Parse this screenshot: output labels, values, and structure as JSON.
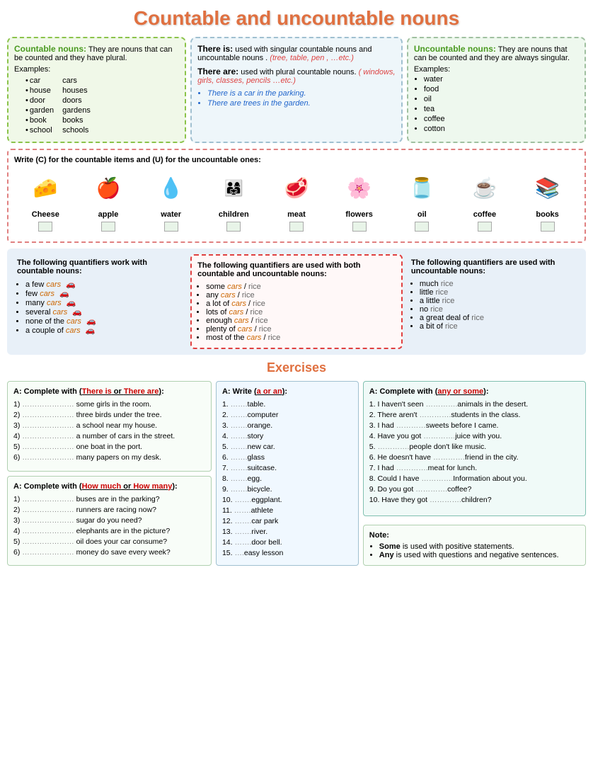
{
  "title": "Countable and uncountable nouns",
  "countable": {
    "title": "Countable nouns:",
    "desc": "They are nouns that can be counted and they have plural.",
    "examples_label": "Examples:",
    "items": [
      {
        "singular": "car",
        "plural": "cars"
      },
      {
        "singular": "house",
        "plural": "houses"
      },
      {
        "singular": "door",
        "plural": "doors"
      },
      {
        "singular": "garden",
        "plural": "gardens"
      },
      {
        "singular": "book",
        "plural": "books"
      },
      {
        "singular": "school",
        "plural": "schools"
      }
    ]
  },
  "there": {
    "there_is_title": "There is:",
    "there_is_desc": "used with singular countable nouns and uncountable nouns .",
    "there_is_examples": "(tree, table, pen , …etc.)",
    "there_are_title": "There are:",
    "there_are_desc": "used with plural countable nouns.",
    "there_are_examples": "( windows, girls, classes, pencils …etc.)",
    "bullets": [
      "There is a car in the parking.",
      "There are trees in the garden."
    ]
  },
  "uncountable": {
    "title": "Uncountable nouns:",
    "desc": "They are nouns that can be counted and they are always singular.",
    "examples_label": "Examples:",
    "items": [
      "water",
      "food",
      "oil",
      "tea",
      "coffee",
      "cotton"
    ]
  },
  "write_exercise": {
    "title": "Write (C) for the countable items and (U) for the uncountable ones:",
    "items": [
      {
        "label": "Cheese",
        "icon": "🧀"
      },
      {
        "label": "apple",
        "icon": "🍎"
      },
      {
        "label": "water",
        "icon": "💧"
      },
      {
        "label": "children",
        "icon": "👨‍👩‍👧"
      },
      {
        "label": "meat",
        "icon": "🥩"
      },
      {
        "label": "flowers",
        "icon": "🌸"
      },
      {
        "label": "oil",
        "icon": "🫙"
      },
      {
        "label": "coffee",
        "icon": "☕"
      },
      {
        "label": "books",
        "icon": "📚"
      }
    ]
  },
  "quantifiers": {
    "countable_title": "The following quantifiers work with countable nouns:",
    "countable_items": [
      "a few cars",
      "few cars",
      "many  cars",
      "several cars",
      "none of the cars",
      "a couple of cars"
    ],
    "both_title": "The following quantifiers are used with both countable and uncountable nouns:",
    "both_items": [
      "some cars / rice",
      "any cars / rice",
      "a lot of cars / rice",
      "lots of cars / rice",
      "enough cars / rice",
      "plenty of cars / rice",
      "most of the cars / rice"
    ],
    "uncountable_title": "The following quantifiers are used with uncountable nouns:",
    "uncountable_items": [
      "much rice",
      "little rice",
      "a little rice",
      "no rice",
      "a great deal of rice",
      "a bit of rice"
    ]
  },
  "exercises_title": "Exercises",
  "ex1": {
    "title": "A: Complete with (There is or There are):",
    "items": [
      "………………… some girls in the room.",
      "………………… three birds under the tree.",
      "………………… a school near my house.",
      "………………… a number of cars in the street.",
      "………………… one boat in the port.",
      "………………… many papers on my desk."
    ]
  },
  "ex2": {
    "title": "A: Complete with (How much  or How many):",
    "items": [
      "………………… buses are in the parking?",
      "………………… runners are racing now?",
      "………………… sugar do you need?",
      "………………… elephants are in the picture?",
      "………………… oil does your car consume?",
      "………………… money do save every week?"
    ]
  },
  "ex3": {
    "title": "A: Write (a or an):",
    "items": [
      "…….table.",
      "…….computer",
      "…….orange.",
      "…….story",
      "…….new car.",
      "…….glass",
      "…….suitcase.",
      "…….egg.",
      "…….bicycle.",
      "…….eggplant.",
      "…….athlete",
      "…….car park",
      "…….river.",
      "…….door bell.",
      "….easy lesson"
    ]
  },
  "ex4": {
    "title": "A: Complete with (any or some):",
    "items": [
      "I haven't seen ………….animals in the desert.",
      "There aren't ………….students in the class.",
      "I had …………sweets before I came.",
      "Have you got ………….juice with you.",
      "………….people don't like music.",
      "He doesn't have ………….friend in the city.",
      "I had ………….meat for lunch.",
      "Could I have ………….Information about you.",
      "Do you got ………….coffee?",
      "Have they got ………….children?"
    ]
  },
  "note": {
    "title": "Note:",
    "items": [
      "Some is used with positive statements.",
      "Any is used with questions and negative sentences."
    ]
  }
}
